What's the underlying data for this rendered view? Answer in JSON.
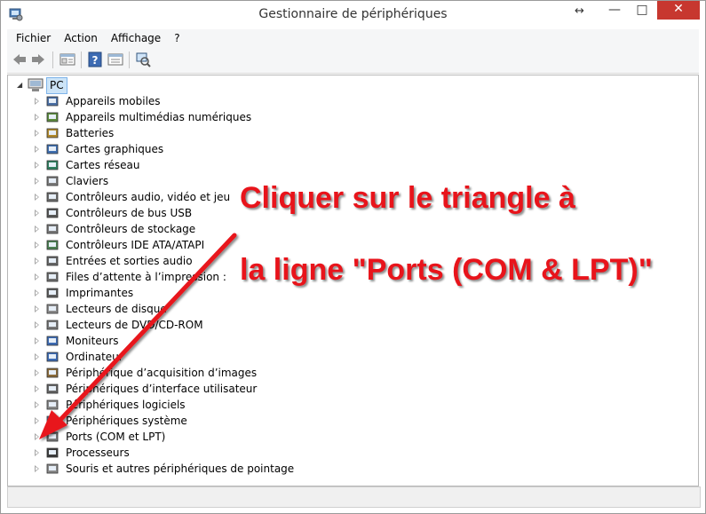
{
  "window": {
    "title": "Gestionnaire de périphériques",
    "controls": {
      "minimize": "—",
      "maximize": "□",
      "close": "✕",
      "resize": "↔"
    }
  },
  "menu": [
    "Fichier",
    "Action",
    "Affichage",
    "?"
  ],
  "toolbar": {
    "buttons": [
      "back-arrow-icon",
      "forward-arrow-icon",
      "properties-icon",
      "help-icon",
      "view-icon",
      "scan-hardware-icon"
    ]
  },
  "tree": {
    "root": "PC",
    "items": [
      {
        "label": "Appareils mobiles",
        "icon": "mobile-device-icon"
      },
      {
        "label": "Appareils multimédias numériques",
        "icon": "multimedia-icon"
      },
      {
        "label": "Batteries",
        "icon": "battery-icon"
      },
      {
        "label": "Cartes graphiques",
        "icon": "display-adapter-icon"
      },
      {
        "label": "Cartes réseau",
        "icon": "network-adapter-icon"
      },
      {
        "label": "Claviers",
        "icon": "keyboard-icon"
      },
      {
        "label": "Contrôleurs audio, vidéo et jeu",
        "icon": "audio-icon"
      },
      {
        "label": "Contrôleurs de bus USB",
        "icon": "usb-icon"
      },
      {
        "label": "Contrôleurs de stockage",
        "icon": "storage-icon"
      },
      {
        "label": "Contrôleurs IDE ATA/ATAPI",
        "icon": "ide-icon"
      },
      {
        "label": "Entrées et sorties audio",
        "icon": "audio-io-icon"
      },
      {
        "label": "Files d’attente à l’impression :",
        "icon": "print-queue-icon"
      },
      {
        "label": "Imprimantes",
        "icon": "printer-icon"
      },
      {
        "label": "Lecteurs de disque",
        "icon": "disk-drive-icon"
      },
      {
        "label": "Lecteurs de DVD/CD-ROM",
        "icon": "dvd-icon"
      },
      {
        "label": "Moniteurs",
        "icon": "monitor-icon"
      },
      {
        "label": "Ordinateur",
        "icon": "computer-icon"
      },
      {
        "label": "Périphérique d’acquisition d’images",
        "icon": "imaging-icon"
      },
      {
        "label": "Périphériques d’interface utilisateur",
        "icon": "hid-icon"
      },
      {
        "label": "Périphériques logiciels",
        "icon": "software-device-icon"
      },
      {
        "label": "Périphériques système",
        "icon": "system-device-icon"
      },
      {
        "label": "Ports (COM et LPT)",
        "icon": "port-icon"
      },
      {
        "label": "Processeurs",
        "icon": "processor-icon"
      },
      {
        "label": "Souris et autres périphériques de pointage",
        "icon": "mouse-icon"
      }
    ]
  },
  "annotation": {
    "line1": "Cliquer sur le triangle à",
    "line2": "la ligne \"Ports (COM & LPT)\"",
    "color": "#e8141b"
  }
}
